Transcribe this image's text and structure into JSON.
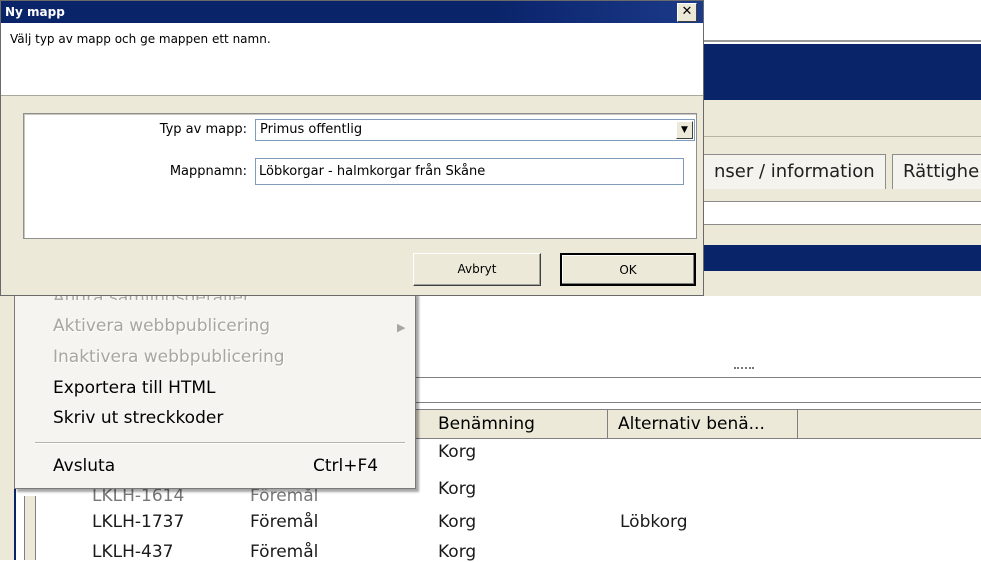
{
  "background_window": {
    "tabs": [
      "nser / information",
      "Rättighe"
    ]
  },
  "context_menu": {
    "items": [
      {
        "label": "Andra samlingsdetaljer",
        "enabled": false
      },
      {
        "label": "Aktivera webbpublicering",
        "enabled": false,
        "has_submenu": true
      },
      {
        "label": "Inaktivera webbpublicering",
        "enabled": false
      },
      {
        "label": "Exportera till HTML",
        "enabled": true
      },
      {
        "label": "Skriv ut streckkoder",
        "enabled": true
      },
      {
        "label": "Avsluta",
        "enabled": true,
        "shortcut": "Ctrl+F4"
      }
    ],
    "submenu_arrow": "▶"
  },
  "grid": {
    "columns": [
      "Benämning",
      "Alternativ benä..."
    ],
    "rows": [
      {
        "id": "",
        "type": "",
        "name": "Korg",
        "alt": ""
      },
      {
        "id": "LKLH-1614",
        "type": "Föremål",
        "name": "Korg",
        "alt": ""
      },
      {
        "id": "LKLH-1737",
        "type": "Föremål",
        "name": "Korg",
        "alt": "Löbkorg"
      },
      {
        "id": "LKLH-437",
        "type": "Föremål",
        "name": "Korg",
        "alt": ""
      }
    ]
  },
  "dialog": {
    "title": "Ny mapp",
    "close_glyph": "✕",
    "instruction": "Välj typ av mapp och ge mappen ett namn.",
    "folder_type_label": "Typ av mapp:",
    "folder_type_value": "Primus offentlig",
    "folder_name_label": "Mappnamn:",
    "folder_name_value": "Löbkorgar - halmkorgar från Skåne",
    "cancel_label": "Avbryt",
    "ok_label": "OK",
    "dropdown_glyph": "▼"
  },
  "colors": {
    "titlebar": "#0a246a",
    "window_face": "#ece9d8",
    "disabled_text": "#a7a6a0"
  }
}
